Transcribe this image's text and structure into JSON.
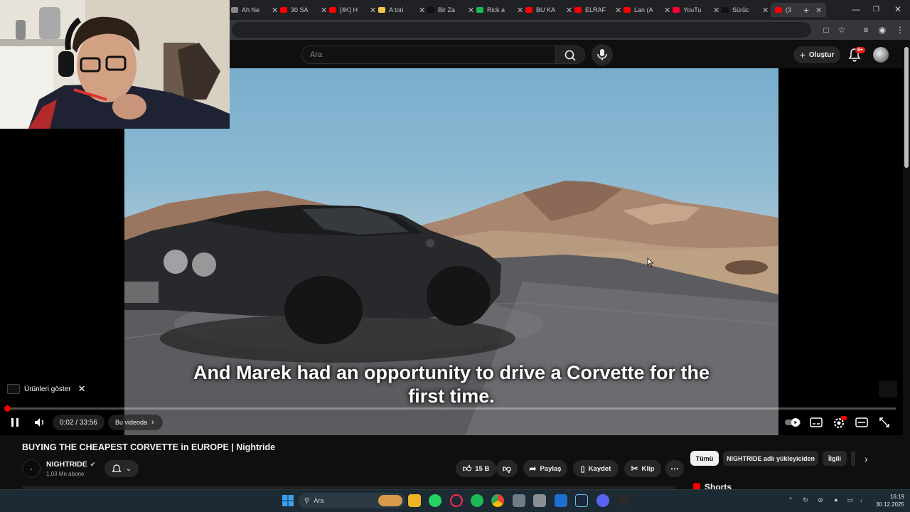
{
  "browser": {
    "tabs": [
      {
        "label": "Ah Ne",
        "color": "#888888"
      },
      {
        "label": "30 SA",
        "color": "#ff0000"
      },
      {
        "label": "[4K] H",
        "color": "#ff0000"
      },
      {
        "label": "A tori",
        "color": "#f2c94c"
      },
      {
        "label": "Bir Za",
        "color": "#111111"
      },
      {
        "label": "Rick a",
        "color": "#1db954"
      },
      {
        "label": "BU KA",
        "color": "#ff0000"
      },
      {
        "label": "ELRAF",
        "color": "#ff0000"
      },
      {
        "label": "Lan (A",
        "color": "#ff0000"
      },
      {
        "label": "YouTu",
        "color": "#ff0033"
      },
      {
        "label": "Sürüc",
        "color": "#111111"
      },
      {
        "label": "(3",
        "color": "#ff0000"
      }
    ],
    "new_tab": "+"
  },
  "masthead": {
    "search_placeholder": "Ara",
    "create_label": "Oluştur",
    "notification_badge": "9+"
  },
  "player": {
    "subtitle_line1": "And Marek had an opportunity to drive a Corvette for the",
    "subtitle_line2": "first time.",
    "products_label": "Ürünleri göster",
    "time": "0:02 / 33:56",
    "chapter_label": "Bu videoda",
    "progress": 0.001
  },
  "video_info": {
    "title": "BUYING THE CHEAPEST CORVETTE in EUROPE | Nightride",
    "channel_name": "NIGHTRIDE",
    "subscribers": "1,03 Mn abone",
    "likes": "15 B",
    "share_label": "Paylaş",
    "save_label": "Kaydet",
    "clip_label": "Klip"
  },
  "chips": [
    "Tümü",
    "NIGHTRIDE adlı yükleyiciden",
    "İlgili"
  ],
  "shorts_label": "Shorts",
  "taskbar": {
    "search_placeholder": "Ara",
    "time": "16:19",
    "date": "30.12.2025"
  }
}
